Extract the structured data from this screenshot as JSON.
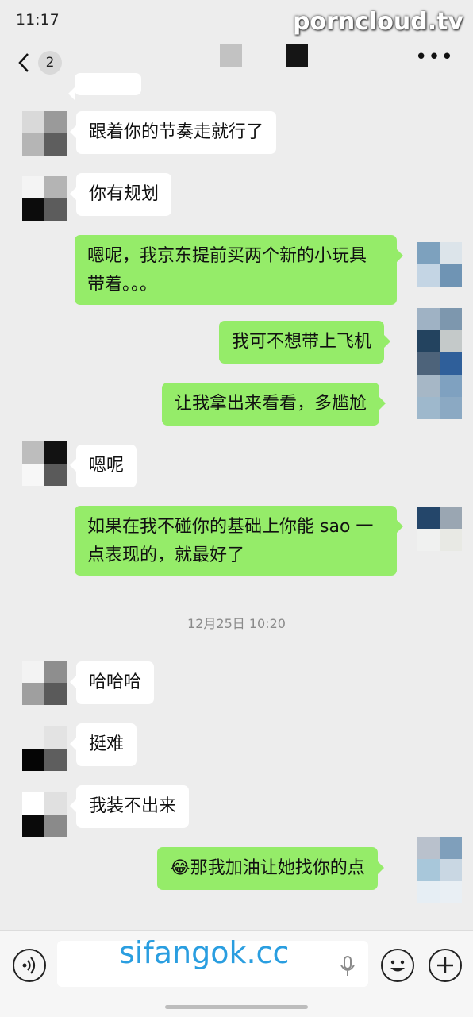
{
  "status": {
    "time": "11:17"
  },
  "watermark_top": "porncloud.tv",
  "watermark_bottom": "sifangok.cc",
  "nav": {
    "unread_count": "2",
    "more_icon": "ellipsis-icon"
  },
  "messages": [
    {
      "side": "left",
      "text": "跟着你的节奏走就行了"
    },
    {
      "side": "left",
      "text": "你有规划"
    },
    {
      "side": "right",
      "line1": "嗯呢，我京东提前买两个新的小玩具",
      "line2": "带着。。。"
    },
    {
      "side": "right",
      "text": "我可不想带上飞机"
    },
    {
      "side": "right",
      "text": "让我拿出来看看，多尴尬"
    },
    {
      "side": "left",
      "text": "嗯呢"
    },
    {
      "side": "right",
      "line1": "如果在我不碰你的基础上你能 sao 一",
      "line2": "点表现的，就最好了"
    },
    {
      "side": "left",
      "text": "哈哈哈"
    },
    {
      "side": "left",
      "text": "挺难"
    },
    {
      "side": "left",
      "text": "我装不出来"
    },
    {
      "side": "right",
      "emoji": "😂",
      "text": "那我加油让她找你的点"
    }
  ],
  "timestamp": "12月25日 10:20",
  "colors": {
    "background": "#ededed",
    "green_bubble": "#95ec69",
    "white_bubble": "#ffffff"
  }
}
